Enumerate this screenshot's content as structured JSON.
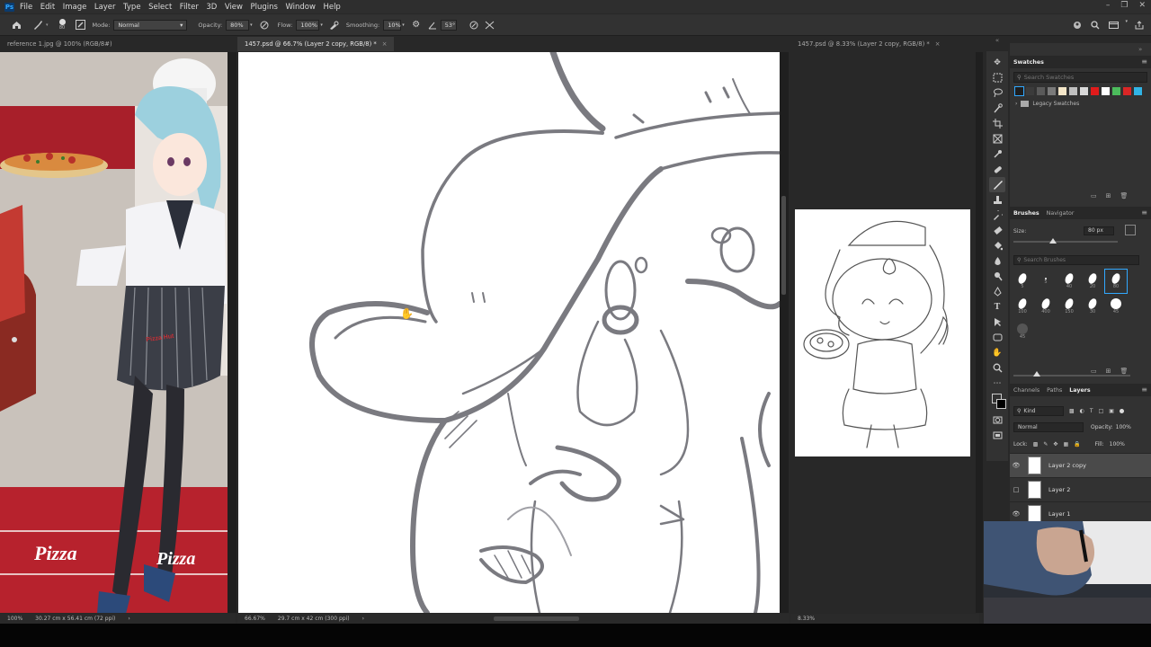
{
  "app": {
    "logo": "Ps"
  },
  "menu": [
    "File",
    "Edit",
    "Image",
    "Layer",
    "Type",
    "Select",
    "Filter",
    "3D",
    "View",
    "Plugins",
    "Window",
    "Help"
  ],
  "options": {
    "brush_size": "80",
    "mode_label": "Mode:",
    "mode_value": "Normal",
    "opacity_label": "Opacity:",
    "opacity_value": "80%",
    "flow_label": "Flow:",
    "flow_value": "100%",
    "smoothing_label": "Smoothing:",
    "smoothing_value": "10%",
    "angle_value": "53°"
  },
  "tabs": {
    "doc1": "reference 1.jpg @ 100% (RGB/8#)",
    "doc2": "1457.psd @ 66.7% (Layer 2 copy, RGB/8) *",
    "doc3": "1457.psd @ 8.33% (Layer 2 copy, RGB/8) *"
  },
  "status": {
    "doc1_zoom": "100%",
    "doc1_size": "30.27 cm x 56.41 cm (72 ppi)",
    "doc2_zoom": "66.67%",
    "doc2_size": "29.7 cm x 42 cm (300 ppi)",
    "doc3_zoom": "8.33%"
  },
  "reference": {
    "sign1": "Pizza",
    "sign2": "Pizza",
    "apron_logo": "Pizza Hut"
  },
  "swatches": {
    "title": "Swatches",
    "search_placeholder": "Search Swatches",
    "colors": [
      "#1e1e1e",
      "#3b3b3b",
      "#5a5a5a",
      "#7a7a7a",
      "#f4e6c8",
      "#c0c0c0",
      "#d9d9d9",
      "#e01b1b",
      "#ffffff",
      "#4cbb5c",
      "#d92626",
      "#31b4e6"
    ],
    "group": "Legacy Swatches"
  },
  "brushes": {
    "tab1": "Brushes",
    "tab2": "Navigator",
    "size_label": "Size:",
    "size_value": "80 px",
    "search_placeholder": "Search Brushes",
    "presets": [
      "5",
      "5",
      "40",
      "20",
      "80",
      "100",
      "400",
      "150",
      "30",
      "45",
      "45"
    ]
  },
  "layers": {
    "tabs": [
      "Channels",
      "Paths",
      "Layers"
    ],
    "kind": "Kind",
    "blend": "Normal",
    "opacity_label": "Opacity:",
    "opacity_value": "100%",
    "lock_label": "Lock:",
    "fill_label": "Fill:",
    "fill_value": "100%",
    "items": [
      {
        "name": "Layer 2 copy",
        "visible": true,
        "selected": true
      },
      {
        "name": "Layer 2",
        "visible": false,
        "selected": false
      },
      {
        "name": "Layer 1",
        "visible": true,
        "selected": false
      }
    ]
  }
}
